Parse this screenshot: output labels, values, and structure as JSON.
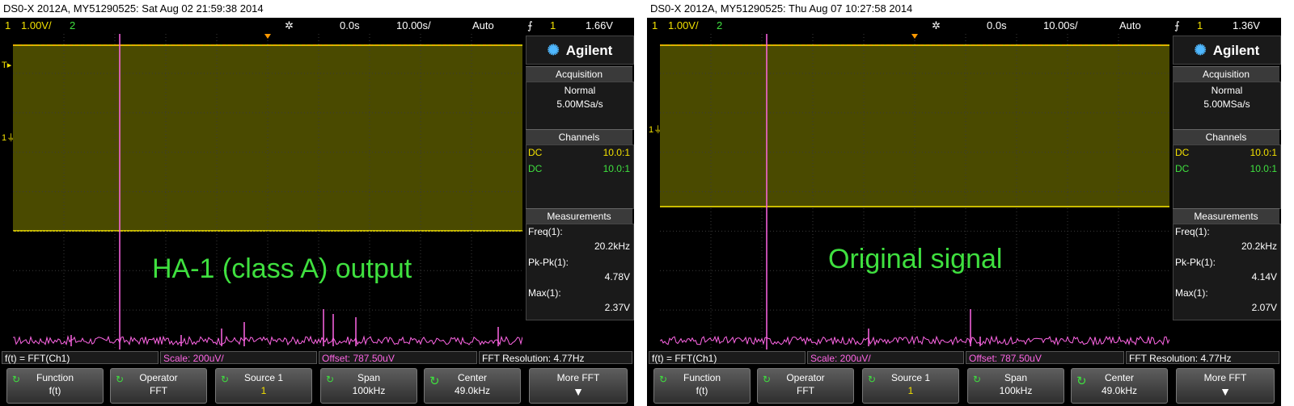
{
  "left": {
    "caption": "DS0-X 2012A, MY51290525: Sat Aug 02 21:59:38 2014",
    "topbar": {
      "ch1": "1",
      "ch1_scale": "1.00V/",
      "ch2": "2",
      "time_offset": "0.0s",
      "time_scale": "10.00s/",
      "mode": "Auto",
      "trig_symbol": "⨍",
      "trig_ch": "1",
      "trig_level": "1.66V"
    },
    "overlay": "HA-1 (class A) output",
    "brand": "Agilent",
    "acquisition": {
      "title": "Acquisition",
      "mode": "Normal",
      "rate": "5.00MSa/s"
    },
    "channels": {
      "title": "Channels",
      "rows": [
        {
          "coupling": "DC",
          "probe": "10.0:1",
          "color": "#f2e000"
        },
        {
          "coupling": "DC",
          "probe": "10.0:1",
          "color": "#3fe03f"
        }
      ]
    },
    "measurements": {
      "title": "Measurements",
      "items": [
        {
          "label": "Freq(1):",
          "value": "20.2kHz"
        },
        {
          "label": "Pk-Pk(1):",
          "value": "4.78V"
        },
        {
          "label": "Max(1):",
          "value": "2.37V"
        }
      ]
    },
    "status": {
      "func": "f(t) = FFT(Ch1)",
      "scale": "Scale: 200uV/",
      "offset": "Offset: 787.50uV",
      "resolution": "FFT Resolution: 4.77Hz"
    },
    "softkeys": [
      {
        "label": "Function",
        "value": "f(t)"
      },
      {
        "label": "Operator",
        "value": "FFT"
      },
      {
        "label": "Source 1",
        "value": "1"
      },
      {
        "label": "Span",
        "value": "100kHz"
      },
      {
        "label": "Center",
        "value": "49.0kHz"
      },
      {
        "label": "More FFT",
        "value": ""
      }
    ]
  },
  "right": {
    "caption": "DS0-X 2012A, MY51290525: Thu Aug 07 10:27:58 2014",
    "topbar": {
      "ch1": "1",
      "ch1_scale": "1.00V/",
      "ch2": "2",
      "time_offset": "0.0s",
      "time_scale": "10.00s/",
      "mode": "Auto",
      "trig_symbol": "⨍",
      "trig_ch": "1",
      "trig_level": "1.36V"
    },
    "overlay": "Original signal",
    "brand": "Agilent",
    "acquisition": {
      "title": "Acquisition",
      "mode": "Normal",
      "rate": "5.00MSa/s"
    },
    "channels": {
      "title": "Channels",
      "rows": [
        {
          "coupling": "DC",
          "probe": "10.0:1",
          "color": "#f2e000"
        },
        {
          "coupling": "DC",
          "probe": "10.0:1",
          "color": "#3fe03f"
        }
      ]
    },
    "measurements": {
      "title": "Measurements",
      "items": [
        {
          "label": "Freq(1):",
          "value": "20.2kHz"
        },
        {
          "label": "Pk-Pk(1):",
          "value": "4.14V"
        },
        {
          "label": "Max(1):",
          "value": "2.07V"
        }
      ]
    },
    "status": {
      "func": "f(t) = FFT(Ch1)",
      "scale": "Scale: 200uV/",
      "offset": "Offset: 787.50uV",
      "resolution": "FFT Resolution: 4.77Hz"
    },
    "softkeys": [
      {
        "label": "Function",
        "value": "f(t)"
      },
      {
        "label": "Operator",
        "value": "FFT"
      },
      {
        "label": "Source 1",
        "value": "1"
      },
      {
        "label": "Span",
        "value": "100kHz"
      },
      {
        "label": "Center",
        "value": "49.0kHz"
      },
      {
        "label": "More FFT",
        "value": ""
      }
    ]
  },
  "colors": {
    "ch1": "#f2e000",
    "ch2": "#3fe03f",
    "math": "#ff66e6",
    "trace_band": "#4a4a00",
    "grid": "#3a3a3a",
    "trigger_marker": "#ff9900"
  }
}
